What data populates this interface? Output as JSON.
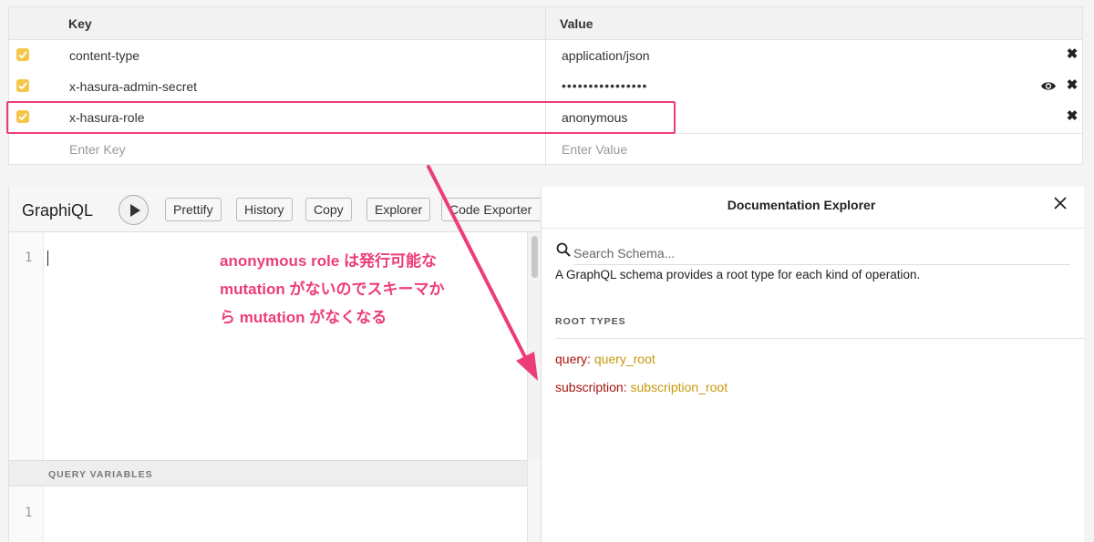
{
  "headers_table": {
    "columns": {
      "key": "Key",
      "value": "Value"
    },
    "rows": [
      {
        "checked": true,
        "key": "content-type",
        "value": "application/json"
      },
      {
        "checked": true,
        "key": "x-hasura-admin-secret",
        "value": "••••••••••••••••"
      },
      {
        "checked": true,
        "key": "x-hasura-role",
        "value": "anonymous"
      }
    ],
    "new_row": {
      "key_placeholder": "Enter Key",
      "value_placeholder": "Enter Value"
    }
  },
  "graphiql": {
    "title": "GraphiQL",
    "buttons": {
      "prettify": "Prettify",
      "history": "History",
      "copy": "Copy",
      "explorer": "Explorer",
      "code_exporter": "Code Exporter"
    },
    "editor_line": "1",
    "query_variables_label": "QUERY VARIABLES",
    "variables_line": "1"
  },
  "annotation": "anonymous role は発行可能な mutation がないのでスキーマから mutation がなくなる",
  "docs": {
    "title": "Documentation Explorer",
    "search_placeholder": "Search Schema...",
    "description": "A GraphQL schema provides a root type for each kind of operation.",
    "root_types_label": "ROOT TYPES",
    "root_types": [
      {
        "field": "query",
        "type": "query_root"
      },
      {
        "field": "subscription",
        "type": "subscription_root"
      }
    ]
  },
  "colors": {
    "accent_pink": "#ec3d7a",
    "checkbox": "#f5c64a",
    "field_name": "#a8130d",
    "type_name": "#c8990a"
  }
}
